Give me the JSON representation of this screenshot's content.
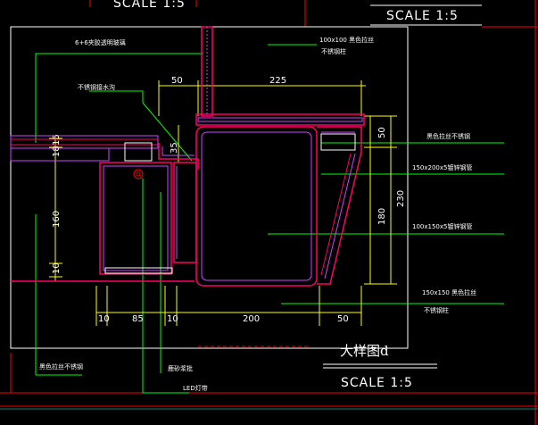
{
  "drawing": {
    "title": "大样图d",
    "scale_labels": [
      "SCALE 1:5",
      "SCALE 1:5",
      "SCALE 1:5"
    ]
  },
  "annotations": {
    "glass": "6+6夹胶透明玻璃",
    "steel_top": "100x100 黑色拉丝",
    "steel_top_2": "不锈钢柱",
    "water_trough": "不锈钢接水沟",
    "black_steel": "黑色拉丝不锈钢",
    "tube_200": "150x200x5镀锌钢管",
    "tube_150": "100x150x5镀锌钢管",
    "col_150": "150x150 黑色拉丝",
    "col_150_2": "不锈钢柱",
    "black_steel_bottom": "黑色拉丝不锈钢",
    "sand_wall": "鹿砂浆批",
    "led": "LED灯带"
  },
  "dimensions": {
    "top": [
      "50",
      "225"
    ],
    "bottom": [
      "10",
      "85",
      "10",
      "200",
      "50"
    ],
    "left": [
      "18",
      "15",
      "160",
      "10"
    ],
    "mid": "35",
    "right": [
      "50",
      "180",
      "230"
    ]
  },
  "colors": {
    "background": "#000000",
    "frame": "#ffffff",
    "annotation_leader": "#00ff00",
    "dimension_line": "#ffff00",
    "outline": "#ff0066",
    "hatch": "#cc44ff",
    "grid": "#ff0000",
    "detail": "#00ffff"
  }
}
